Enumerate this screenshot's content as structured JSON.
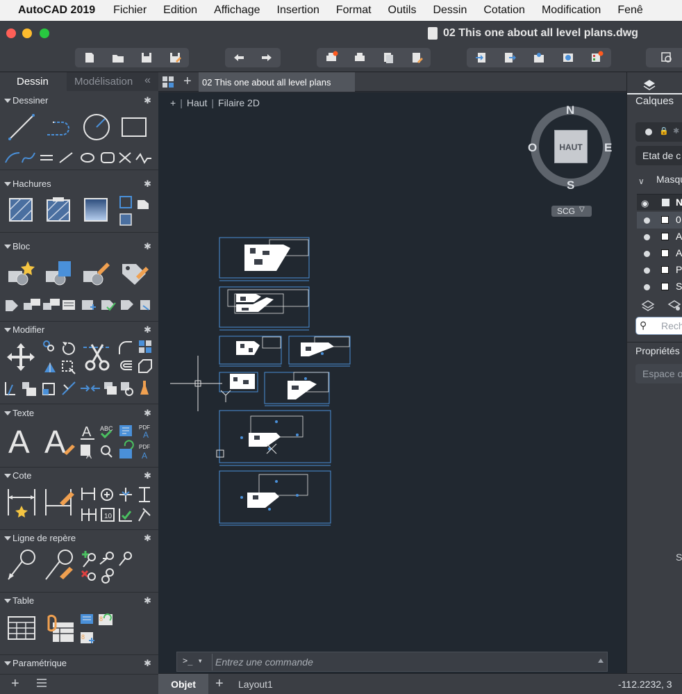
{
  "menubar": {
    "app": "AutoCAD 2019",
    "items": [
      "Fichier",
      "Edition",
      "Affichage",
      "Insertion",
      "Format",
      "Outils",
      "Dessin",
      "Cotation",
      "Modification",
      "Fenê"
    ]
  },
  "window": {
    "title": "02 This one about all level plans.dwg"
  },
  "palette": {
    "tabs": {
      "dessin": "Dessin",
      "modelisation": "Modélisation",
      "collapse": "«"
    },
    "sections": {
      "dessiner": "Dessiner",
      "hachures": "Hachures",
      "bloc": "Bloc",
      "modifier": "Modifier",
      "texte": "Texte",
      "cote": "Cote",
      "ligne": "Ligne de repère",
      "table": "Table",
      "parametrique": "Paramétrique"
    }
  },
  "doctabs": {
    "active": "02 This one about all level plans"
  },
  "viewport": {
    "view": "Haut",
    "style": "Filaire 2D"
  },
  "viewcube": {
    "north": "N",
    "south": "S",
    "east": "E",
    "west": "O",
    "face": "HAUT",
    "ucs": "SCG"
  },
  "command": {
    "prompt": ">_ ▾",
    "placeholder": "Entrez une commande"
  },
  "status": {
    "objet": "Objet",
    "layout": "Layout1",
    "coords": "-112.2232, 3"
  },
  "rpanel": {
    "calques": "Calques",
    "etat": "Etat de c",
    "masque": "Masqu",
    "header_n": "N",
    "layers": [
      "0",
      "A",
      "A",
      "P",
      "S"
    ],
    "search": "Rech",
    "proprietes": "Propriétés",
    "espace": "Espace o",
    "s_letter": "S"
  },
  "colors": {
    "accent_blue": "#4a90d9",
    "canvas": "#212830",
    "panel": "#3b3e44"
  }
}
